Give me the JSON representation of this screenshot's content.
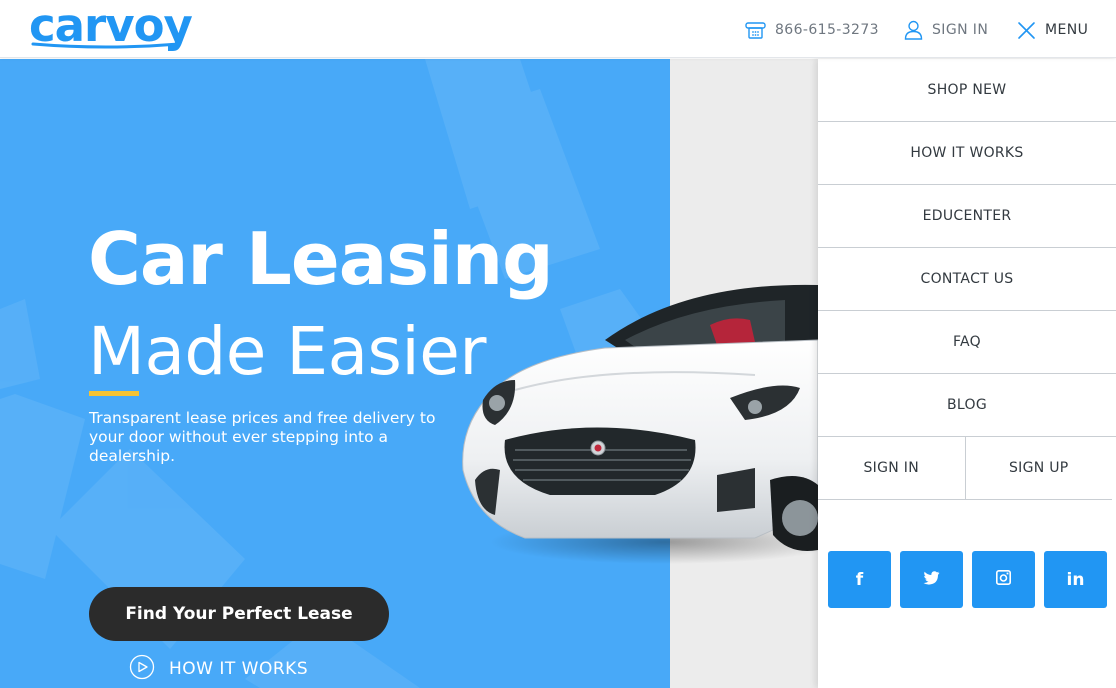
{
  "header": {
    "logo_text": "carvoy",
    "phone": {
      "icon": "phone-icon",
      "number": "866-615-3273"
    },
    "sign_in": {
      "icon": "user-icon",
      "label": "SIGN IN"
    },
    "menu": {
      "icon": "close-icon",
      "label": "MENU"
    }
  },
  "hero": {
    "headline_line1": "Car Leasing",
    "headline_line2": "Made Easier",
    "subtitle": "Transparent lease prices and free delivery to your door without ever stepping into a dealership.",
    "cta_label": "Find Your Perfect Lease",
    "how_it_works": {
      "icon": "play-circle-icon",
      "label": "HOW IT WORKS"
    }
  },
  "menu_panel": {
    "items": [
      {
        "label": "SHOP NEW"
      },
      {
        "label": "HOW IT WORKS"
      },
      {
        "label": "EDUCENTER"
      },
      {
        "label": "CONTACT US"
      },
      {
        "label": "FAQ"
      },
      {
        "label": "BLOG"
      }
    ],
    "auth": {
      "sign_in": "SIGN IN",
      "sign_up": "SIGN UP"
    },
    "social": [
      {
        "icon": "facebook-icon",
        "glyph": "f"
      },
      {
        "icon": "twitter-icon",
        "glyph": ""
      },
      {
        "icon": "instagram-icon",
        "glyph": ""
      },
      {
        "icon": "linkedin-icon",
        "glyph": "in"
      }
    ]
  },
  "colors": {
    "brand_blue": "#2196f3",
    "hero_blue": "#48a9f8",
    "accent_yellow": "#f6c334",
    "cta_dark": "#2b2b2b"
  }
}
